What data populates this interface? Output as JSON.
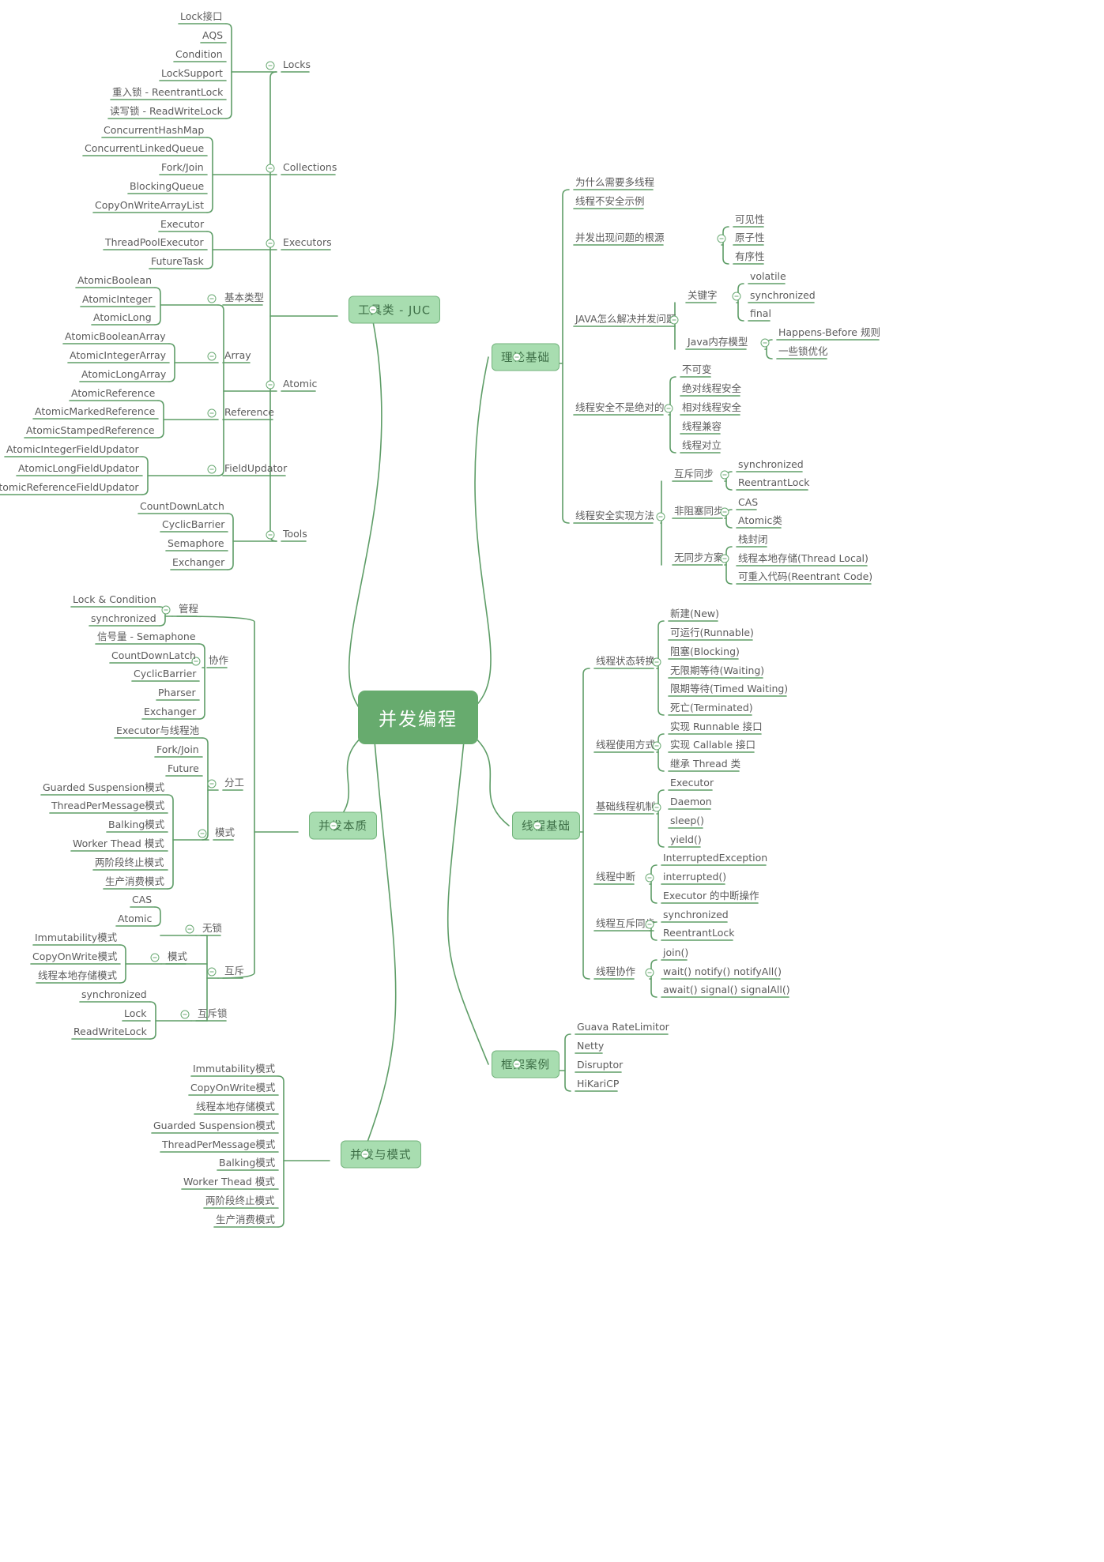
{
  "title": "并发编程",
  "colors": {
    "line": "#5e9d67",
    "root_bg": "#67ab6e",
    "branch_bg": "#a8ddb0",
    "branch_border": "#73b37c",
    "branch_text": "#3e6f47",
    "leaf_text": "#5b5b5b"
  },
  "root": {
    "label": "并发编程"
  },
  "branches": [
    {
      "id": "juc",
      "label": "工具类 - JUC",
      "children": [
        {
          "label": "Locks",
          "children": [
            {
              "label": "Lock接口"
            },
            {
              "label": "AQS"
            },
            {
              "label": "Condition"
            },
            {
              "label": "LockSupport"
            },
            {
              "label": "重入锁 - ReentrantLock"
            },
            {
              "label": "读写锁 - ReadWriteLock"
            }
          ]
        },
        {
          "label": "Collections",
          "children": [
            {
              "label": "ConcurrentHashMap"
            },
            {
              "label": "ConcurrentLinkedQueue"
            },
            {
              "label": "Fork/Join"
            },
            {
              "label": "BlockingQueue"
            },
            {
              "label": "CopyOnWriteArrayList"
            }
          ]
        },
        {
          "label": "Executors",
          "children": [
            {
              "label": "Executor"
            },
            {
              "label": "ThreadPoolExecutor"
            },
            {
              "label": "FutureTask"
            }
          ]
        },
        {
          "label": "Atomic",
          "children": [
            {
              "label": "基本类型",
              "children": [
                {
                  "label": "AtomicBoolean"
                },
                {
                  "label": "AtomicInteger"
                },
                {
                  "label": "AtomicLong"
                }
              ]
            },
            {
              "label": "Array",
              "children": [
                {
                  "label": "AtomicBooleanArray"
                },
                {
                  "label": "AtomicIntegerArray"
                },
                {
                  "label": "AtomicLongArray"
                }
              ]
            },
            {
              "label": "Reference",
              "children": [
                {
                  "label": "AtomicReference"
                },
                {
                  "label": "AtomicMarkedReference"
                },
                {
                  "label": "AtomicStampedReference"
                }
              ]
            },
            {
              "label": "FieldUpdator",
              "children": [
                {
                  "label": "AtomicIntegerFieldUpdator"
                },
                {
                  "label": "AtomicLongFieldUpdator"
                },
                {
                  "label": "AtomicReferenceFieldUpdator"
                }
              ]
            }
          ]
        },
        {
          "label": "Tools",
          "children": [
            {
              "label": "CountDownLatch"
            },
            {
              "label": "CyclicBarrier"
            },
            {
              "label": "Semaphore"
            },
            {
              "label": "Exchanger"
            }
          ]
        }
      ]
    },
    {
      "id": "theory",
      "label": "理论基础",
      "children": [
        {
          "label": "为什么需要多线程"
        },
        {
          "label": "线程不安全示例"
        },
        {
          "label": "并发出现问题的根源",
          "children": [
            {
              "label": "可见性"
            },
            {
              "label": "原子性"
            },
            {
              "label": "有序性"
            }
          ]
        },
        {
          "label": "JAVA怎么解决并发问题",
          "children": [
            {
              "label": "关键字",
              "children": [
                {
                  "label": "volatile"
                },
                {
                  "label": "synchronized"
                },
                {
                  "label": "final"
                }
              ]
            },
            {
              "label": "Java内存模型",
              "children": [
                {
                  "label": "Happens-Before 规则"
                },
                {
                  "label": "一些锁优化"
                }
              ]
            }
          ]
        },
        {
          "label": "线程安全不是绝对的",
          "children": [
            {
              "label": "不可变"
            },
            {
              "label": "绝对线程安全"
            },
            {
              "label": "相对线程安全"
            },
            {
              "label": "线程兼容"
            },
            {
              "label": "线程对立"
            }
          ]
        },
        {
          "label": "线程安全实现方法",
          "children": [
            {
              "label": "互斥同步",
              "children": [
                {
                  "label": "synchronized"
                },
                {
                  "label": "ReentrantLock"
                }
              ]
            },
            {
              "label": "非阻塞同步",
              "children": [
                {
                  "label": "CAS"
                },
                {
                  "label": "Atomic类"
                }
              ]
            },
            {
              "label": "无同步方案",
              "children": [
                {
                  "label": "栈封闭"
                },
                {
                  "label": "线程本地存储(Thread Local)"
                },
                {
                  "label": "可重入代码(Reentrant Code)"
                }
              ]
            }
          ]
        }
      ]
    },
    {
      "id": "essence",
      "label": "并发本质",
      "children": [
        {
          "label": "管程",
          "children": [
            {
              "label": "Lock & Condition"
            },
            {
              "label": "synchronized"
            }
          ]
        },
        {
          "label": "协作",
          "children": [
            {
              "label": "信号量 - Semaphone"
            },
            {
              "label": "CountDownLatch"
            },
            {
              "label": "CyclicBarrier"
            },
            {
              "label": "Pharser"
            },
            {
              "label": "Exchanger"
            }
          ]
        },
        {
          "label": "分工",
          "children": [
            {
              "label": "Executor与线程池"
            },
            {
              "label": "Fork/Join"
            },
            {
              "label": "Future"
            },
            {
              "label": "模式",
              "children": [
                {
                  "label": "Guarded Suspension模式"
                },
                {
                  "label": "ThreadPerMessage模式"
                },
                {
                  "label": "Balking模式"
                },
                {
                  "label": "Worker Thead 模式"
                },
                {
                  "label": "两阶段终止模式"
                },
                {
                  "label": "生产消费模式"
                }
              ]
            }
          ]
        },
        {
          "label": "互斥",
          "children": [
            {
              "label": "无锁",
              "children": [
                {
                  "label": "CAS"
                },
                {
                  "label": "Atomic"
                }
              ]
            },
            {
              "label": "模式",
              "children": [
                {
                  "label": "Immutability模式"
                },
                {
                  "label": "CopyOnWrite模式"
                },
                {
                  "label": "线程本地存储模式"
                }
              ]
            },
            {
              "label": "互斥锁",
              "children": [
                {
                  "label": "synchronized"
                },
                {
                  "label": "Lock"
                },
                {
                  "label": "ReadWriteLock"
                }
              ]
            }
          ]
        }
      ]
    },
    {
      "id": "threadbasic",
      "label": "线程基础",
      "children": [
        {
          "label": "线程状态转换",
          "children": [
            {
              "label": "新建(New)"
            },
            {
              "label": "可运行(Runnable)"
            },
            {
              "label": "阻塞(Blocking)"
            },
            {
              "label": "无限期等待(Waiting)"
            },
            {
              "label": "限期等待(Timed Waiting)"
            },
            {
              "label": "死亡(Terminated)"
            }
          ]
        },
        {
          "label": "线程使用方式",
          "children": [
            {
              "label": "实现 Runnable 接口"
            },
            {
              "label": "实现 Callable 接口"
            },
            {
              "label": "继承 Thread 类"
            }
          ]
        },
        {
          "label": "基础线程机制",
          "children": [
            {
              "label": "Executor"
            },
            {
              "label": "Daemon"
            },
            {
              "label": "sleep()"
            },
            {
              "label": "yield()"
            }
          ]
        },
        {
          "label": "线程中断",
          "children": [
            {
              "label": "InterruptedException"
            },
            {
              "label": "interrupted()"
            },
            {
              "label": "Executor 的中断操作"
            }
          ]
        },
        {
          "label": "线程互斥同步",
          "children": [
            {
              "label": "synchronized"
            },
            {
              "label": "ReentrantLock"
            }
          ]
        },
        {
          "label": "线程协作",
          "children": [
            {
              "label": "join()"
            },
            {
              "label": "wait() notify() notifyAll()"
            },
            {
              "label": "await() signal() signalAll()"
            }
          ]
        }
      ]
    },
    {
      "id": "frameworks",
      "label": "框架案例",
      "children": [
        {
          "label": "Guava RateLimitor"
        },
        {
          "label": "Netty"
        },
        {
          "label": "Disruptor"
        },
        {
          "label": "HiKariCP"
        }
      ]
    },
    {
      "id": "patterns",
      "label": "并发与模式",
      "children": [
        {
          "label": "Immutability模式"
        },
        {
          "label": "CopyOnWrite模式"
        },
        {
          "label": "线程本地存储模式"
        },
        {
          "label": "Guarded Suspension模式"
        },
        {
          "label": "ThreadPerMessage模式"
        },
        {
          "label": "Balking模式"
        },
        {
          "label": "Worker Thead 模式"
        },
        {
          "label": "两阶段终止模式"
        },
        {
          "label": "生产消费模式"
        }
      ]
    }
  ]
}
